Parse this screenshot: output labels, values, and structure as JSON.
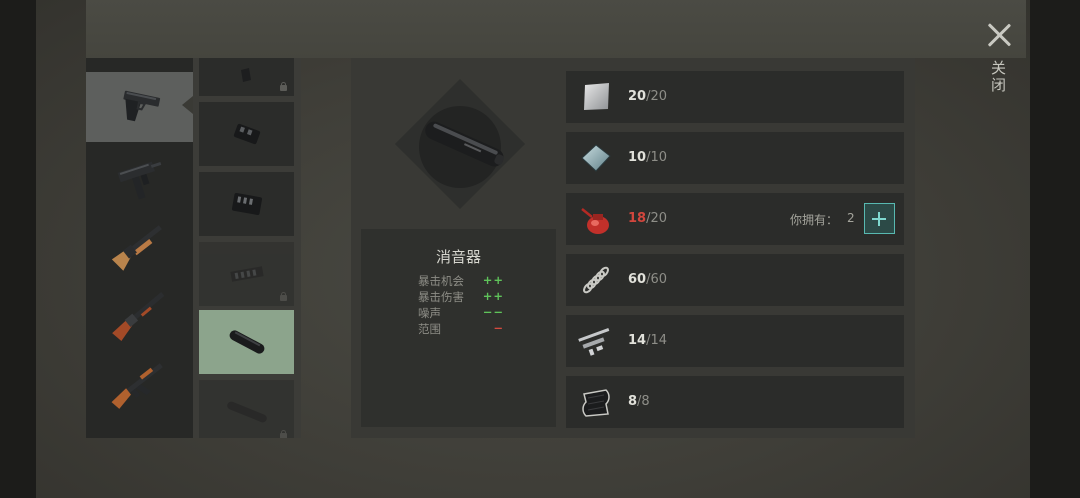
{
  "header": {
    "close_label": "关闭"
  },
  "weapons": [
    {
      "name": "pistol",
      "selected": true
    },
    {
      "name": "uzi",
      "selected": false
    },
    {
      "name": "shotgun",
      "selected": false
    },
    {
      "name": "double-barrel-shotgun",
      "selected": false
    },
    {
      "name": "assault-rifle",
      "selected": false
    }
  ],
  "attachments": [
    {
      "name": "grip",
      "locked": true
    },
    {
      "name": "muzzle-brake-small",
      "locked": false
    },
    {
      "name": "muzzle-brake-large",
      "locked": false
    },
    {
      "name": "compensator",
      "locked": true
    },
    {
      "name": "silencer",
      "locked": false,
      "selected": true
    },
    {
      "name": "long-silencer",
      "locked": true
    }
  ],
  "selected_item": {
    "title": "消音器",
    "stats": [
      {
        "label": "暴击机会",
        "value": "++",
        "color": "#5fc35a"
      },
      {
        "label": "暴击伤害",
        "value": "++",
        "color": "#5fc35a"
      },
      {
        "label": "噪声",
        "value": "−−",
        "color": "#5fc35a"
      },
      {
        "label": "范围",
        "value": "−",
        "color": "#d44a3f"
      }
    ]
  },
  "parts": [
    {
      "icon": "metal-plate-icon",
      "current": "20",
      "total": "/20"
    },
    {
      "icon": "glass-plate-icon",
      "current": "10",
      "total": "/10"
    },
    {
      "icon": "oil-can-icon",
      "current": "18",
      "total": "/20",
      "low": true,
      "owned_label": "你拥有：",
      "owned": "2"
    },
    {
      "icon": "spring-icon",
      "current": "60",
      "total": "/60"
    },
    {
      "icon": "gun-parts-icon",
      "current": "14",
      "total": "/14"
    },
    {
      "icon": "carbon-sheet-icon",
      "current": "8",
      "total": "/8"
    }
  ]
}
